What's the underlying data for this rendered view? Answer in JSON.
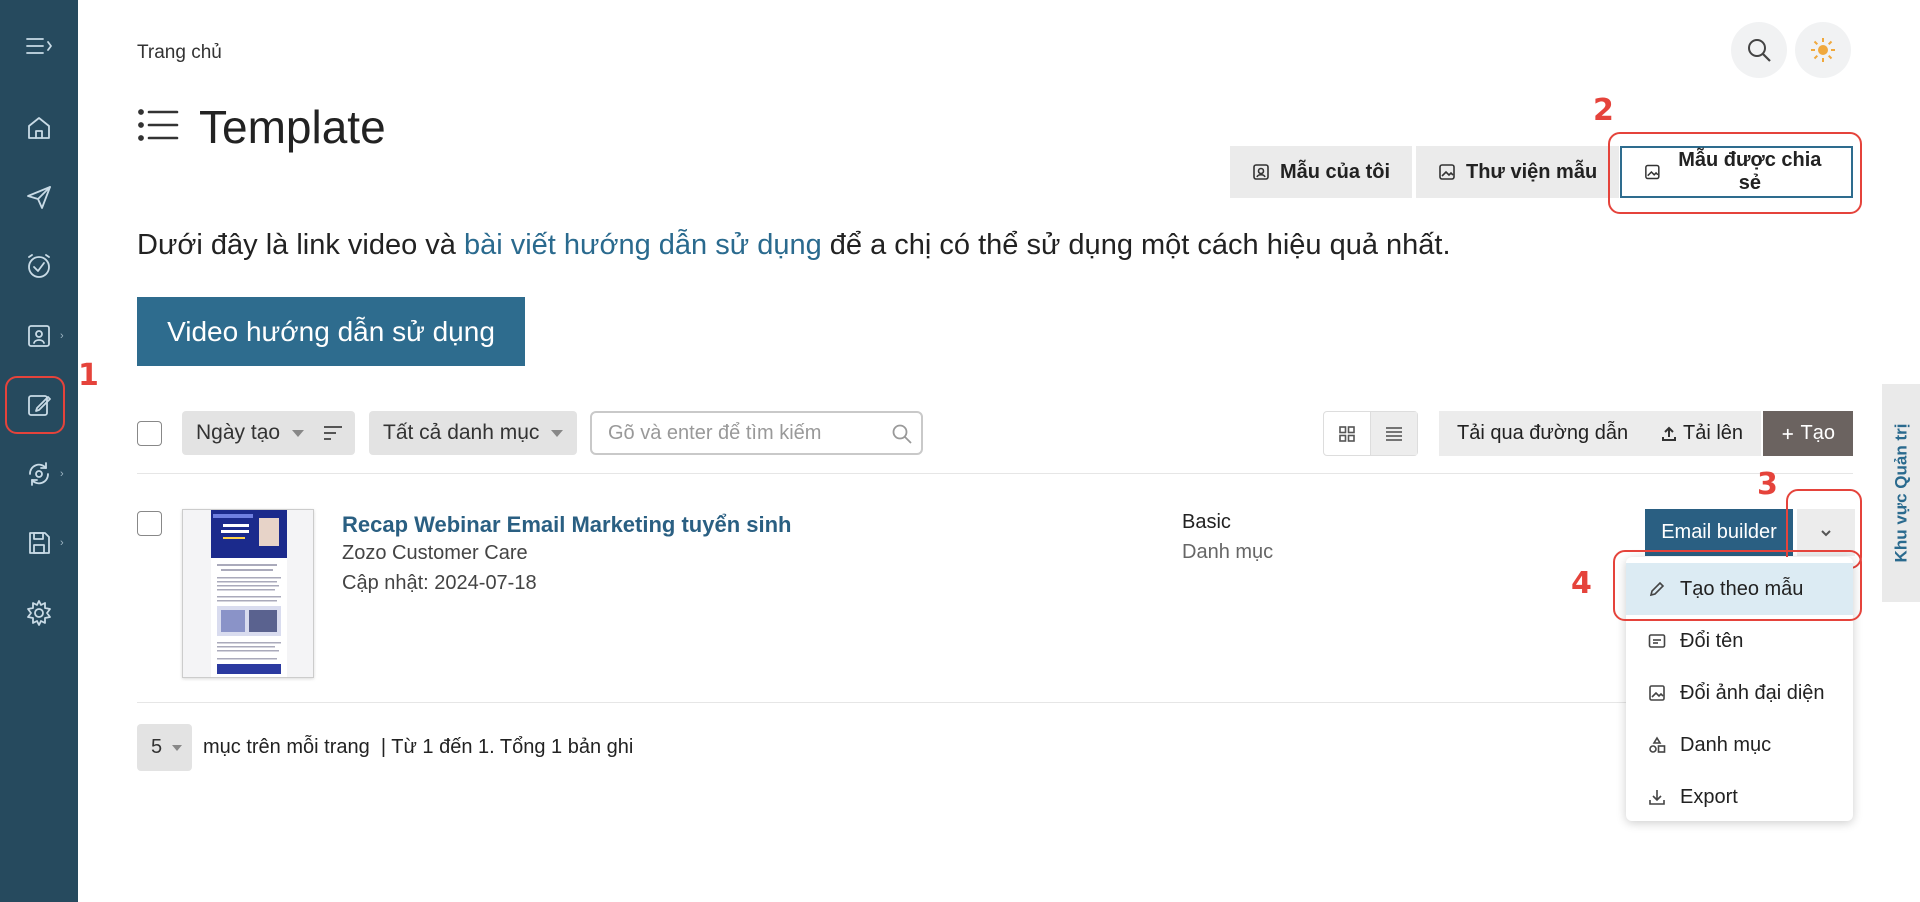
{
  "breadcrumb": "Trang chủ",
  "page_title": "Template",
  "tabs": [
    {
      "label": "Mẫu của tôi",
      "icon": "user-card-icon"
    },
    {
      "label": "Thư viện mẫu",
      "icon": "image-icon"
    },
    {
      "label": "Mẫu được chia sẻ",
      "icon": "image-icon",
      "active": true
    }
  ],
  "intro": {
    "before": "Dưới đây là link video và ",
    "link": "bài viết hướng dẫn sử dụng",
    "after": " để a chị có thể sử dụng một cách hiệu quả nhất."
  },
  "video_button": "Video hướng dẫn sử dụng",
  "toolbar": {
    "sort_select": "Ngày tạo",
    "category_select": "Tất cả danh mục",
    "search_placeholder": "Gõ và enter để tìm kiếm",
    "upload_link": "Tải qua đường dẫn",
    "upload": "Tải lên",
    "create": "Tạo"
  },
  "row": {
    "title": "Recap Webinar Email Marketing tuyển sinh",
    "owner": "Zozo Customer Care",
    "updated": "Cập nhật: 2024-07-18",
    "type": "Basic",
    "category": "Danh mục",
    "action": "Email builder"
  },
  "menu": [
    {
      "label": "Tạo theo mẫu",
      "icon": "pencil-icon"
    },
    {
      "label": "Đổi tên",
      "icon": "rename-icon"
    },
    {
      "label": "Đổi ảnh đại diện",
      "icon": "image-icon"
    },
    {
      "label": "Danh mục",
      "icon": "shapes-icon"
    },
    {
      "label": "Export",
      "icon": "download-icon"
    }
  ],
  "pagination": {
    "per_page": "5",
    "label": "mục trên mỗi trang",
    "summary": "| Từ 1 đến 1. Tổng 1 bản ghi"
  },
  "side_tab": "Khu vực Quản trị",
  "annotations": [
    "1",
    "2",
    "3",
    "4"
  ],
  "colors": {
    "sidebar": "#264a5e",
    "accent": "#2e6c8e",
    "annotation": "#e5433b"
  }
}
